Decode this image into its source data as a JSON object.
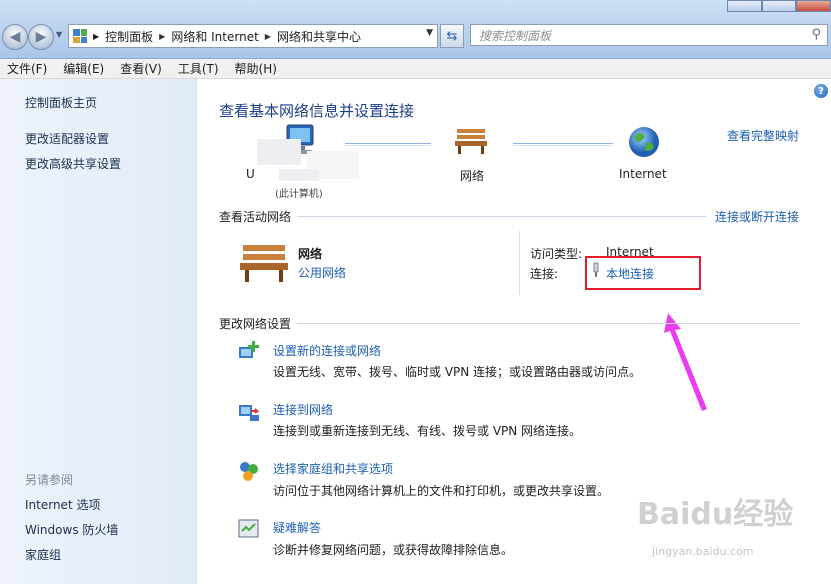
{
  "toolbar": {
    "breadcrumb": [
      "控制面板",
      "网络和 Internet",
      "网络和共享中心"
    ],
    "search_placeholder": "搜索控制面板"
  },
  "menu": [
    "文件(F)",
    "编辑(E)",
    "查看(V)",
    "工具(T)",
    "帮助(H)"
  ],
  "sidebar": {
    "home": "控制面板主页",
    "links": [
      "更改适配器设置",
      "更改高级共享设置"
    ],
    "see_also_title": "另请参阅",
    "see_also": [
      "Internet 选项",
      "Windows 防火墙",
      "家庭组"
    ]
  },
  "main": {
    "title": "查看基本网络信息并设置连接",
    "full_map": "查看完整映射",
    "map": {
      "computer": "U",
      "computer_sub": "(此计算机)",
      "network": "网络",
      "internet": "Internet"
    },
    "active_title": "查看活动网络",
    "connect_disconnect": "连接或断开连接",
    "network": {
      "name": "网络",
      "type": "公用网络",
      "access_label": "访问类型:",
      "access_value": "Internet",
      "conn_label": "连接:",
      "conn_value": "本地连接"
    },
    "change_title": "更改网络设置",
    "tasks": [
      {
        "title": "设置新的连接或网络",
        "desc": "设置无线、宽带、拨号、临时或 VPN 连接；或设置路由器或访问点。"
      },
      {
        "title": "连接到网络",
        "desc": "连接到或重新连接到无线、有线、拨号或 VPN 网络连接。"
      },
      {
        "title": "选择家庭组和共享选项",
        "desc": "访问位于其他网络计算机上的文件和打印机，或更改共享设置。"
      },
      {
        "title": "疑难解答",
        "desc": "诊断并修复网络问题，或获得故障排除信息。"
      }
    ]
  },
  "watermark": {
    "brand": "Baidu经验",
    "url": "jingyan.baidu.com"
  },
  "colors": {
    "link": "#1c5fb3",
    "title": "#1b3f8b",
    "highlight": "#e21e2a",
    "arrow": "#e83df0"
  }
}
